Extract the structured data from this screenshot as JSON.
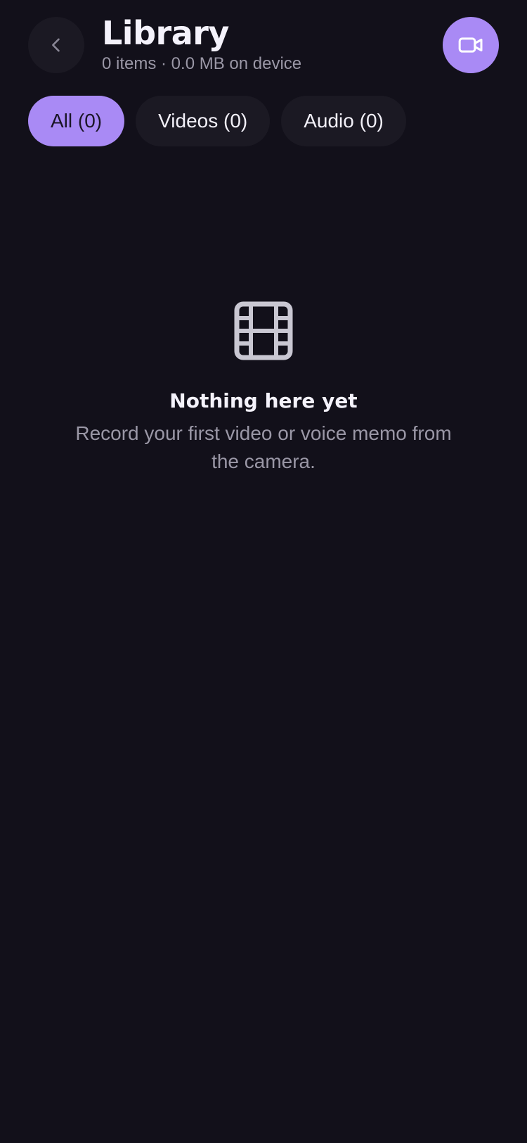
{
  "header": {
    "title": "Library",
    "subtitle": "0 items · 0.0 MB on device",
    "back_icon": "chevron-left-icon",
    "record_icon": "video-camera-icon"
  },
  "tabs": [
    {
      "label": "All (0)",
      "active": true
    },
    {
      "label": "Videos (0)",
      "active": false
    },
    {
      "label": "Audio (0)",
      "active": false
    }
  ],
  "empty_state": {
    "icon": "film-icon",
    "title": "Nothing here yet",
    "message": "Record your first video or voice memo from the camera."
  },
  "colors": {
    "background": "#12101a",
    "accent": "#a98af5",
    "surface": "#1b1923",
    "muted_text": "#9a97a6"
  }
}
